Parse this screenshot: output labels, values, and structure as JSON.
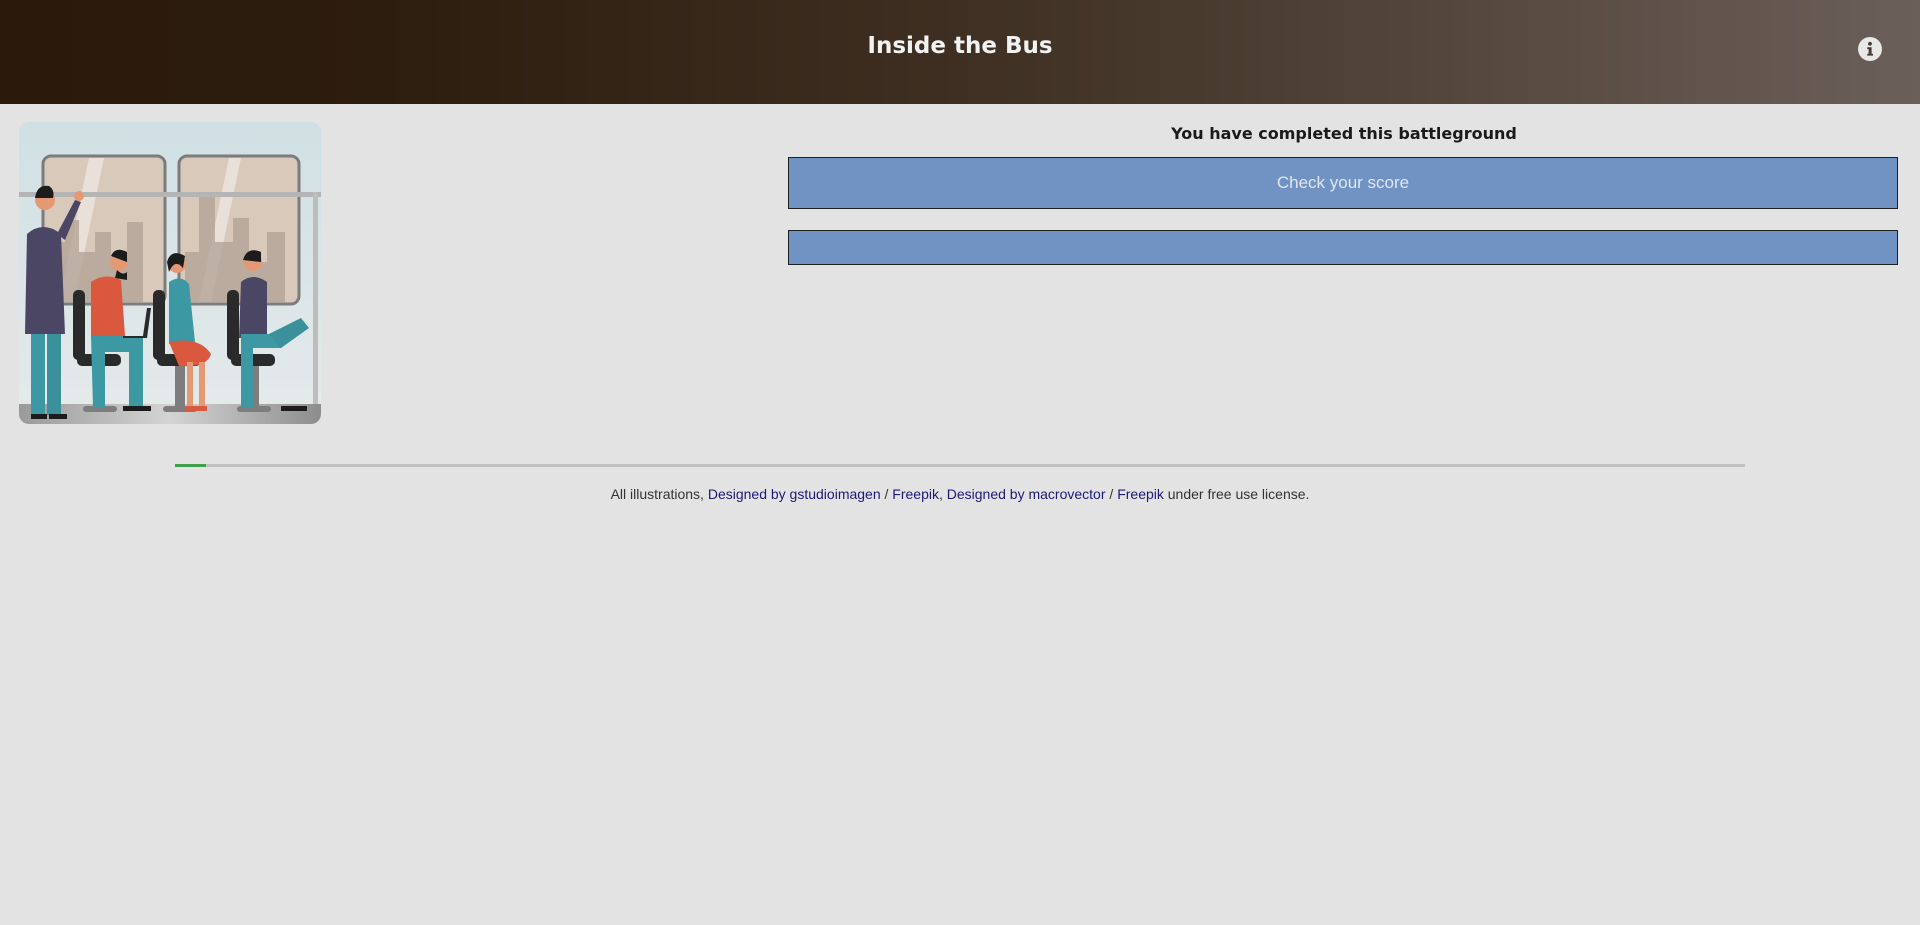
{
  "header": {
    "title": "Inside the Bus",
    "info_icon": "info-icon",
    "gradient_colors": [
      "#2b1a0b",
      "#6b5f5a"
    ]
  },
  "illustration": {
    "subject": "passengers-on-bus"
  },
  "main": {
    "status_text": "You have completed this battleground",
    "score_button_label": "Check your score",
    "secondary_button_label": "",
    "button_color": "#7093c4"
  },
  "progress": {
    "fraction": 0.02,
    "fill_color": "#3f9f4b"
  },
  "footer": {
    "prefix": "All illustrations, ",
    "link1": "Designed by gstudioimagen",
    "sep1": " / ",
    "link2": "Freepik",
    "comma": ", ",
    "link3": "Designed by macrovector",
    "sep2": " / ",
    "link4": "Freepik",
    "suffix": " under free use license."
  }
}
